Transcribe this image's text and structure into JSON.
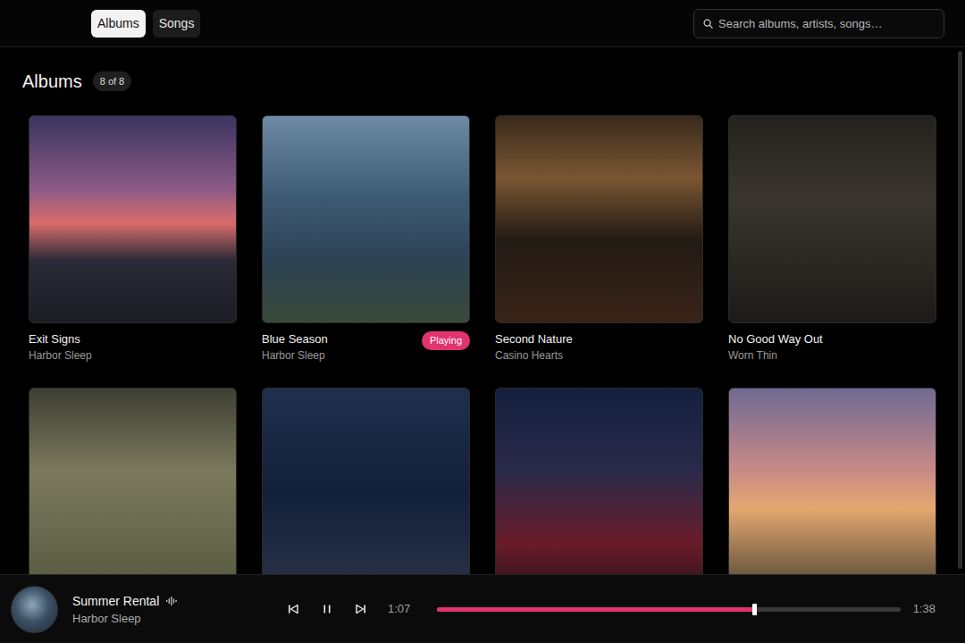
{
  "tabs": [
    {
      "label": "Albums",
      "selected": true
    },
    {
      "label": "Songs",
      "selected": false
    }
  ],
  "search": {
    "placeholder": "Search albums, artists, songs…"
  },
  "heading": {
    "title": "Albums",
    "count": "8 of 8"
  },
  "playing_badge": "Playing",
  "albums": [
    {
      "title": "Exit Signs",
      "artist": "Harbor Sleep",
      "playing": false
    },
    {
      "title": "Blue Season",
      "artist": "Harbor Sleep",
      "playing": true
    },
    {
      "title": "Second Nature",
      "artist": "Casino Hearts",
      "playing": false
    },
    {
      "title": "No Good Way Out",
      "artist": "Worn Thin",
      "playing": false
    },
    {
      "playing": false
    },
    {
      "playing": false
    },
    {
      "playing": false
    },
    {
      "playing": false
    }
  ],
  "player": {
    "title": "Summer Rental",
    "artist": "Harbor Sleep",
    "playing": true,
    "elapsed": "1:07",
    "duration": "1:38",
    "level": 0.685
  }
}
